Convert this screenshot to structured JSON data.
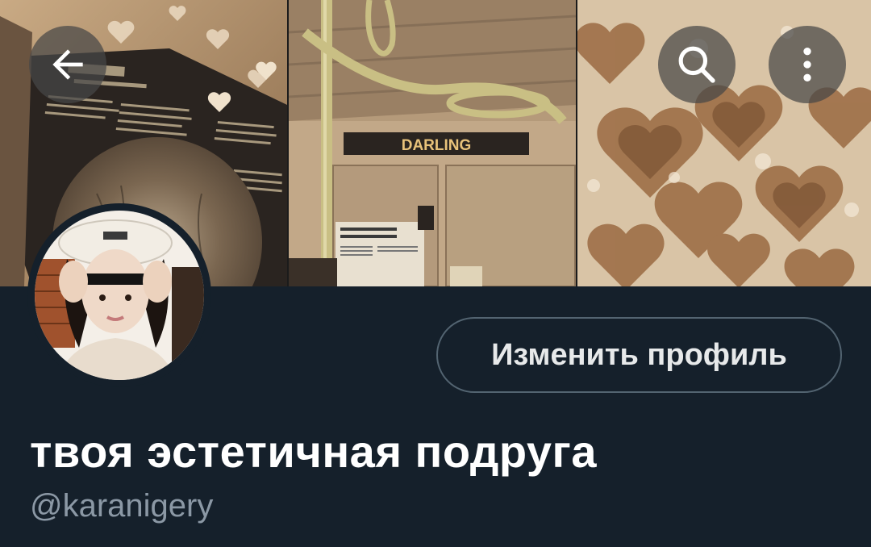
{
  "header": {
    "back_icon": "arrow-left-icon",
    "search_icon": "search-icon",
    "more_icon": "more-vertical-icon",
    "banner_panels": [
      {
        "name": "album-lyrics-photo",
        "caption_lines": [
          "august",
          "written by taylor swift & jack antonoff"
        ]
      },
      {
        "name": "subway-car-photo",
        "sign_text": "DARLING",
        "notice_text": [
          "Authorised Officers",
          "travel on this vehicle"
        ]
      },
      {
        "name": "heart-ice-coffee-photo"
      }
    ]
  },
  "profile": {
    "edit_button_label": "Изменить профиль",
    "display_name": "твоя эстетичная подруга",
    "username": "@karanigery"
  },
  "colors": {
    "background": "#15202b",
    "text_primary": "#ffffff",
    "text_secondary": "#8b98a5",
    "button_border": "#536471"
  }
}
